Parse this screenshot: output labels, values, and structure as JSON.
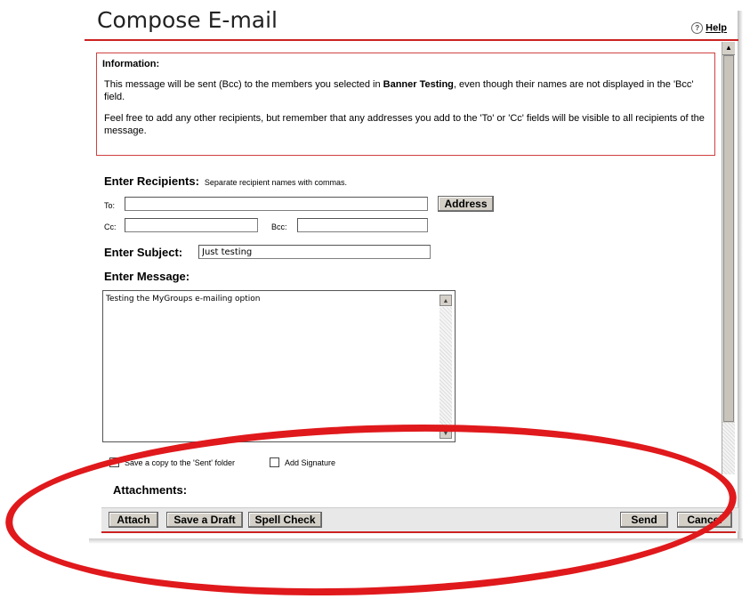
{
  "header": {
    "title": "Compose E-mail",
    "help_label": "Help",
    "help_icon": "?"
  },
  "info": {
    "heading": "Information:",
    "line1_pre": "This message will be sent (Bcc) to the members you selected in ",
    "line1_bold": "Banner Testing",
    "line1_post": ", even though their names are not displayed in the 'Bcc' field.",
    "line2": "Feel free to add any other recipients, but remember that any addresses you add to the 'To' or 'Cc' fields will be visible to all recipients of the message."
  },
  "recipients": {
    "heading": "Enter Recipients:",
    "hint": "Separate recipient names with commas.",
    "to_label": "To:",
    "to_value": "",
    "cc_label": "Cc:",
    "cc_value": "",
    "bcc_label": "Bcc:",
    "bcc_value": "",
    "address_button": "Address"
  },
  "subject": {
    "heading": "Enter Subject:",
    "value": "Just testing"
  },
  "message": {
    "heading": "Enter Message:",
    "value": "Testing the MyGroups e-mailing option"
  },
  "options": {
    "save_copy_label": "Save a copy to the 'Sent' folder",
    "save_copy_checked": true,
    "add_signature_label": "Add Signature",
    "add_signature_checked": false
  },
  "attachments": {
    "heading": "Attachments:"
  },
  "toolbar": {
    "attach": "Attach",
    "save_draft": "Save a Draft",
    "spell_check": "Spell Check",
    "send": "Send",
    "cancel": "Cancel"
  },
  "colors": {
    "accent_red": "#cc2222",
    "annotation_red": "#e0191c",
    "button_face": "#d4d0c8"
  }
}
